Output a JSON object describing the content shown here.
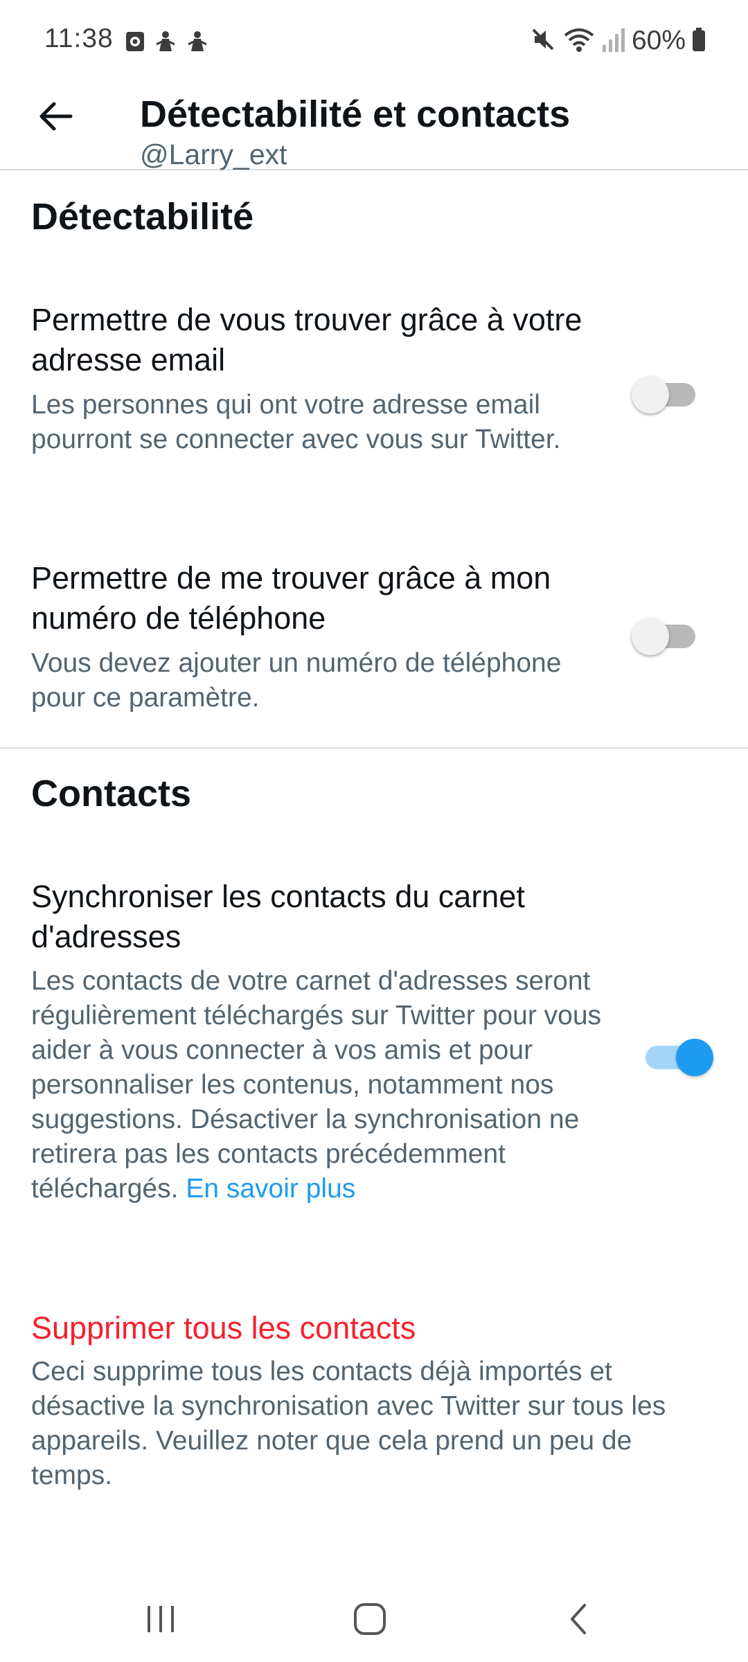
{
  "status_bar": {
    "time": "11:38",
    "battery": "60%"
  },
  "header": {
    "title": "Détectabilité et contacts",
    "subtitle": "@Larry_ext"
  },
  "discoverability": {
    "section_title": "Détectabilité",
    "email_setting": {
      "title": "Permettre de vous trouver grâce à votre adresse email",
      "description": "Les personnes qui ont votre adresse email pourront se connecter avec vous sur Twitter.",
      "enabled": false
    },
    "phone_setting": {
      "title": "Permettre de me trouver grâce à mon numéro de téléphone",
      "description": "Vous devez ajouter un numéro de téléphone pour ce paramètre.",
      "enabled": false
    }
  },
  "contacts": {
    "section_title": "Contacts",
    "sync_setting": {
      "title": "Synchroniser les contacts du carnet d'adresses",
      "description": "Les contacts de votre carnet d'adresses seront régulièrement téléchargés sur Twitter pour vous aider à vous connecter à vos amis et pour personnaliser les contenus, notamment nos suggestions. Désactiver la synchronisation ne retirera pas les contacts précédemment téléchargés.",
      "link_text": "En savoir plus",
      "enabled": true
    },
    "delete_all": {
      "title": "Supprimer tous les contacts",
      "description": "Ceci supprime tous les contacts déjà importés et désactive la synchronisation avec Twitter sur tous les appareils. Veuillez noter que cela prend un peu de temps."
    }
  },
  "colors": {
    "accent": "#1d9bf0",
    "danger": "#f4212e",
    "secondary_text": "#536471"
  },
  "icons": {
    "back": "arrow-left-icon",
    "recents": "recent-apps-icon",
    "home": "home-icon",
    "nav_back": "chevron-left-icon"
  }
}
